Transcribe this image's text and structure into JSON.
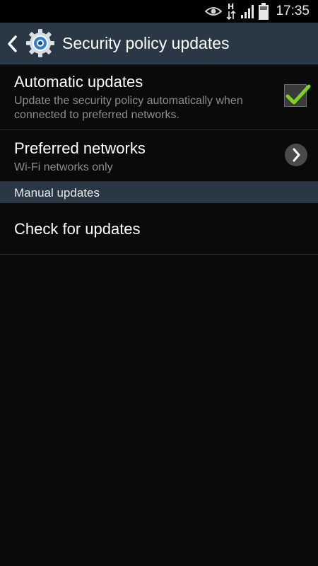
{
  "status_bar": {
    "time": "17:35",
    "icons": [
      "eye-icon",
      "h-data-icon",
      "signal-icon",
      "battery-icon"
    ]
  },
  "action_bar": {
    "title": "Security policy updates",
    "back_icon": "chevron-left-icon",
    "app_icon": "gear-icon"
  },
  "list": {
    "automatic_updates": {
      "title": "Automatic updates",
      "subtitle": "Update the security policy automatically when connected to preferred networks.",
      "checked": true
    },
    "preferred_networks": {
      "title": "Preferred networks",
      "subtitle": "Wi-Fi networks only"
    },
    "section_manual": {
      "label": "Manual updates"
    },
    "check_for_updates": {
      "title": "Check for updates"
    }
  },
  "colors": {
    "background": "#0a0a0a",
    "action_bar": "#2a3744",
    "check_green": "#7ed321",
    "subtitle": "#8d8d8d"
  }
}
